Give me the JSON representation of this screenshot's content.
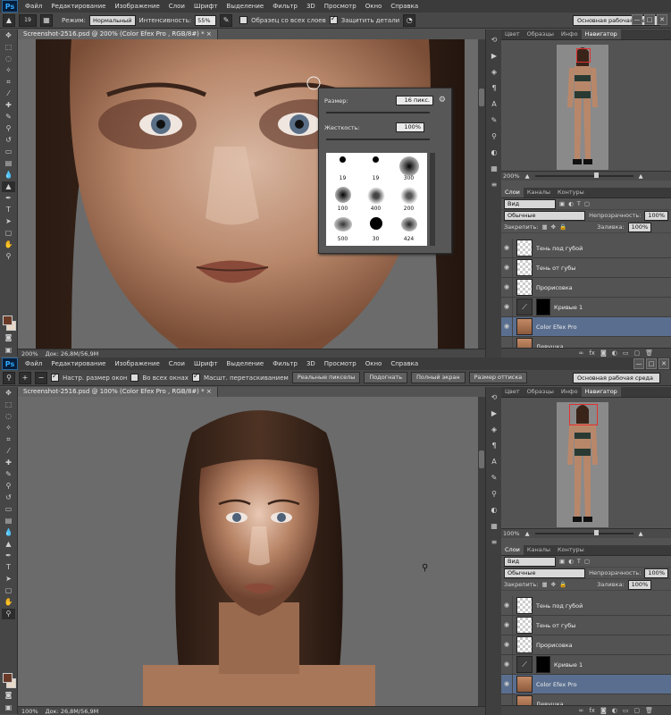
{
  "menu": [
    "Файл",
    "Редактирование",
    "Изображение",
    "Слои",
    "Шрифт",
    "Выделение",
    "Фильтр",
    "3D",
    "Просмотр",
    "Окно",
    "Справка"
  ],
  "ps_logo": "Ps",
  "window_controls": [
    "—",
    "□",
    "✕"
  ],
  "top": {
    "options": {
      "brush_size": "19",
      "mode_label": "Режим:",
      "mode_value": "Нормальный",
      "intensity_label": "Интенсивность:",
      "intensity_value": "55%",
      "sample_all": "Образец со всех слоев",
      "protect": "Защитить детали"
    },
    "workspace": "Основная рабочая среда",
    "doc_title": "Screenshot-2516.psd @ 200% (Color Efex Pro , RGB/8#) *",
    "status_zoom": "200%",
    "status_doc": "Док: 26,8M/56,9M",
    "nav_zoom": "200%",
    "brush_popup": {
      "size_label": "Размер:",
      "size_value": "16 пикс.",
      "hardness_label": "Жесткость:",
      "hardness_value": "100%",
      "brushes": [
        "19",
        "19",
        "300",
        "100",
        "400",
        "200",
        "500",
        "30",
        "424"
      ]
    }
  },
  "bottom": {
    "options": {
      "resize_windows": "Настр. размер окон",
      "all_windows": "Во всех окнах",
      "scrubby": "Масшт. перетаскиванием",
      "btn_actual": "Реальные пикселы",
      "btn_fit": "Подогнать",
      "btn_full": "Полный экран",
      "btn_print": "Размер оттиска"
    },
    "workspace": "Основная рабочая среда",
    "doc_title": "Screenshot-2516.psd @ 100% (Color Efex Pro , RGB/8#) *",
    "status_zoom": "100%",
    "status_doc": "Док: 26,8M/56,9M",
    "nav_zoom": "100%"
  },
  "panel_tabs_top": [
    "Цвет",
    "Образцы",
    "Инфо",
    "Навигатор"
  ],
  "panel_tabs_layers": [
    "Слои",
    "Каналы",
    "Контуры"
  ],
  "layers_panel": {
    "filter": "Вид",
    "blend": "Обычные",
    "opacity_label": "Непрозрачность:",
    "opacity_value": "100%",
    "lock_label": "Закрепить:",
    "fill_label": "Заливка:",
    "fill_value": "100%"
  },
  "layers": [
    "Тень под губой",
    "Тень от губы",
    "Прорисовка",
    "Кривые 1",
    "Color Efex Pro",
    "Девушка"
  ],
  "colors": {
    "fg": "#6a3a28",
    "bg": "#e8d8c8",
    "selection": "#5a6f8f"
  }
}
